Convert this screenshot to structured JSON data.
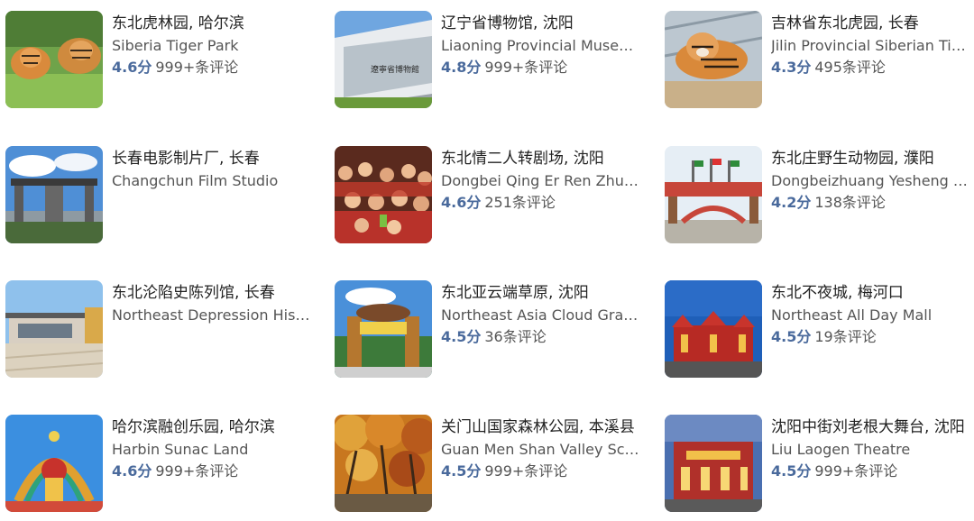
{
  "cards": [
    {
      "title": "东北虎林园, 哈尔滨",
      "subtitle": "Siberia Tiger Park",
      "score": "4.6分",
      "reviews": "999+条评论",
      "image": "tiger-cubs-photo"
    },
    {
      "title": "辽宁省博物馆, 沈阳",
      "subtitle": "Liaoning Provincial Museum",
      "score": "4.8分",
      "reviews": "999+条评论",
      "image": "museum-building-photo"
    },
    {
      "title": "吉林省东北虎园, 长春",
      "subtitle": "Jilin Provincial Siberian Tiger Park",
      "score": "4.3分",
      "reviews": "495条评论",
      "image": "tiger-on-log-photo"
    },
    {
      "title": "长春电影制片厂, 长春",
      "subtitle": "Changchun Film Studio",
      "score": "",
      "reviews": "",
      "image": "film-studio-gate-photo"
    },
    {
      "title": "东北情二人转剧场, 沈阳",
      "subtitle": "Dongbei Qing Er Ren Zhuan Theatre",
      "score": "4.6分",
      "reviews": "251条评论",
      "image": "theatre-audience-photo"
    },
    {
      "title": "东北庄野生动物园, 濮阳",
      "subtitle": "Dongbeizhuang Yesheng Zoo",
      "score": "4.2分",
      "reviews": "138条评论",
      "image": "zoo-gate-photo"
    },
    {
      "title": "东北沦陷史陈列馆, 长春",
      "subtitle": "Northeast Depression History Museum",
      "score": "",
      "reviews": "",
      "image": "history-museum-photo"
    },
    {
      "title": "东北亚云端草原, 沈阳",
      "subtitle": "Northeast Asia Cloud Grassland",
      "score": "4.5分",
      "reviews": "36条评论",
      "image": "grassland-gate-photo"
    },
    {
      "title": "东北不夜城, 梅河口",
      "subtitle": "Northeast All Day Mall",
      "score": "4.5分",
      "reviews": "19条评论",
      "image": "night-city-photo"
    },
    {
      "title": "哈尔滨融创乐园, 哈尔滨",
      "subtitle": "Harbin Sunac Land",
      "score": "4.6分",
      "reviews": "999+条评论",
      "image": "sunac-land-photo"
    },
    {
      "title": "关门山国家森林公园, 本溪县",
      "subtitle": "Guan Men Shan Valley Scenic Area",
      "score": "4.5分",
      "reviews": "999+条评论",
      "image": "autumn-forest-photo"
    },
    {
      "title": "沈阳中街刘老根大舞台, 沈阳",
      "subtitle": "Liu Laogen Theatre",
      "score": "4.5分",
      "reviews": "999+条评论",
      "image": "theatre-facade-photo"
    }
  ]
}
